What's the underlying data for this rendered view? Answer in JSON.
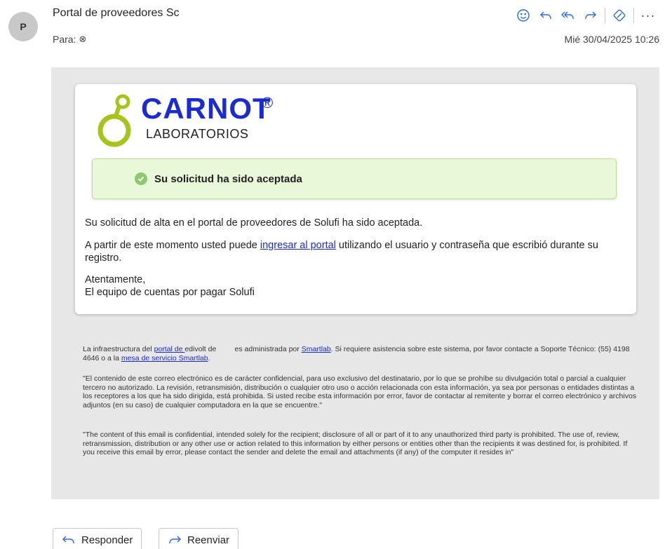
{
  "header": {
    "avatar_initial": "P",
    "sender": "Portal de proveedores Sc",
    "to_label": "Para:",
    "remove_recipient_symbol": "⊗",
    "date": "Mié 30/04/2025 10:26"
  },
  "toolbar": {
    "icons": [
      "emoji-icon",
      "reply-icon",
      "reply-all-icon",
      "forward-icon",
      "loop-icon",
      "more-icon"
    ],
    "more_label": "···"
  },
  "card": {
    "logo": {
      "brand": "CARNOT",
      "registered": "®",
      "subtitle": "LABORATORIOS"
    },
    "alert": "Su solicitud ha sido aceptada",
    "p1": "Su solicitud de alta en el portal de proveedores de Solufi ha sido aceptada.",
    "p2_before": "A partir de este momento usted puede ",
    "p2_link": "ingresar al portal",
    "p2_after": " utilizando el usuario y contraseña que escribió durante su registro.",
    "closing": "Atentamente,",
    "signature": "El equipo de cuentas por pagar Solufi"
  },
  "footer": {
    "infra_1": "La infraestructura del ",
    "infra_link1": "portal de ",
    "infra_2": "edivolt de         es administrada por ",
    "infra_link2": "Smartlab",
    "infra_3": ". Si requiere asistencia sobre este sistema, por favor contacte a Soporte Técnico: (55) 4198 4646 o a la ",
    "infra_link3": "mesa de servicio Smartlab",
    "infra_4": ".",
    "disclaimer_es": "\"El contenido de este correo electrónico es de carácter confidencial, para uso exclusivo del destinatario, por lo que se prohíbe su divulgación total o parcial a cualquier tercero no autorizado. La revisión, retransmisión, distribución o cualquier otro uso o acción relacionada con esta información, ya sea por personas o entidades distintas a los receptores a los que ha sido dirigida, está prohibida. Si usted recibe esta información por error, favor de contactar al remitente y borrar el correo electrónico y archivos adjuntos (en su caso) de cualquier computadora en la que se encuentre.\"",
    "disclaimer_en": "\"The content of this email is confidential, intended solely for the recipient; disclosure of all or part of it to any unauthorized third party is prohibited. The use of, review, retransmission, distribution or any other use or action related to this information by either persons or entities other than the recipients it was destined for, is prohibited. If you receive this email by error, please contact the sender and delete the email and attachments (if any) of the computer it resides in\""
  },
  "buttons": {
    "reply": "Responder",
    "forward": "Reenviar"
  },
  "colors": {
    "accent": "#2b6cd6",
    "brand_blue": "#1a2bd3",
    "brand_green": "#a6c41c",
    "alert_bg": "#e8f8d8",
    "body_bg": "#e7e7e7"
  }
}
